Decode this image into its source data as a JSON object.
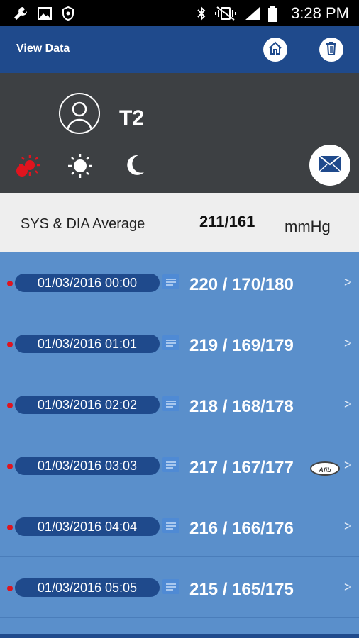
{
  "status_bar": {
    "time": "3:28 PM",
    "icons": [
      "wrench-icon",
      "image-icon",
      "shield-icon",
      "bluetooth-icon",
      "vibrate-icon",
      "signal-icon",
      "battery-icon"
    ]
  },
  "header": {
    "title": "View Data",
    "home_icon": "home-icon",
    "delete_icon": "trash-icon"
  },
  "profile": {
    "name": "T2",
    "avatar_icon": "user-avatar-icon",
    "periods": [
      {
        "icon": "morning-icon",
        "color": "#e0141e",
        "selected": true
      },
      {
        "icon": "sun-icon",
        "color": "#ffffff",
        "selected": false
      },
      {
        "icon": "moon-icon",
        "color": "#ffffff",
        "selected": false
      }
    ],
    "mail_icon": "mail-icon"
  },
  "average": {
    "label": "SYS & DIA Average",
    "value": "211/161",
    "unit": "mmHg"
  },
  "readings": [
    {
      "date": "01/03/2016 00:00",
      "value": "220 / 170/180",
      "afib": false
    },
    {
      "date": "01/03/2016 01:01",
      "value": "219 / 169/179",
      "afib": false
    },
    {
      "date": "01/03/2016 02:02",
      "value": "218 / 168/178",
      "afib": false
    },
    {
      "date": "01/03/2016 03:03",
      "value": "217 / 167/177",
      "afib": true,
      "afib_label": "Afib"
    },
    {
      "date": "01/03/2016 04:04",
      "value": "216 / 166/176",
      "afib": false
    },
    {
      "date": "01/03/2016 05:05",
      "value": "215 / 165/175",
      "afib": false
    }
  ],
  "colors": {
    "header": "#1f4a8c",
    "panel": "#3d4043",
    "list": "#5a8fcb",
    "alert": "#e0141e"
  }
}
